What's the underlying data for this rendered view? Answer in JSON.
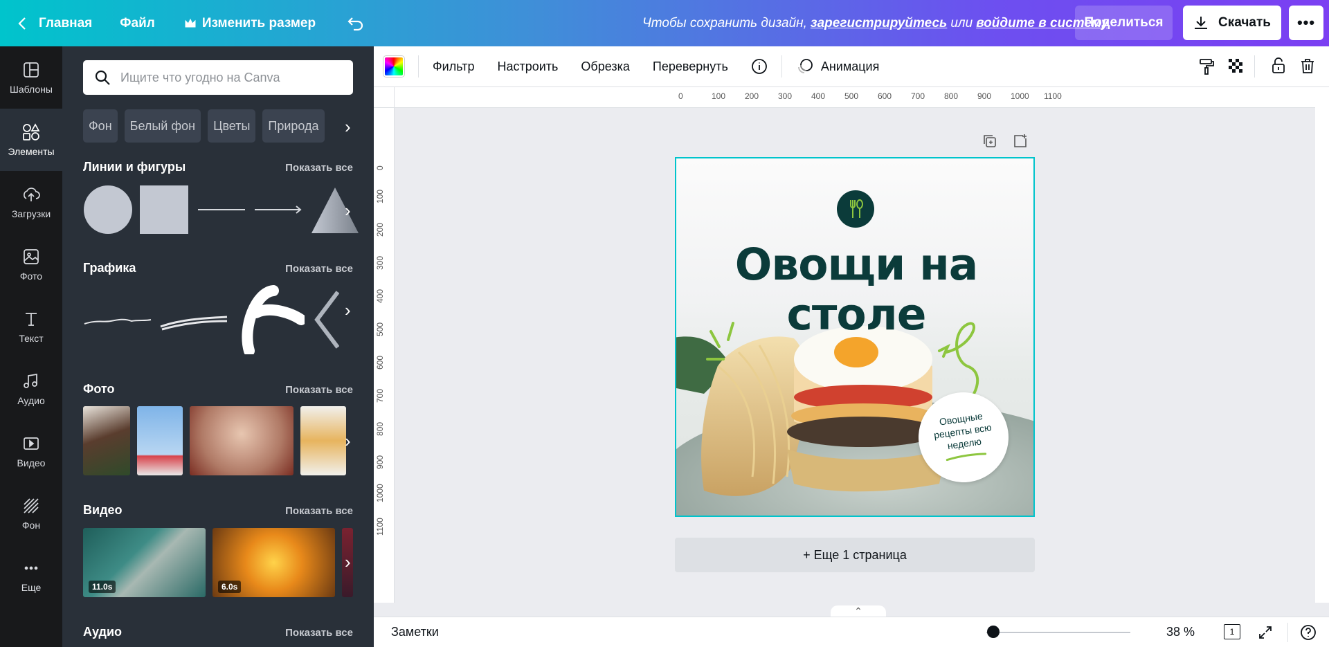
{
  "topbar": {
    "home_label": "Главная",
    "file_label": "Файл",
    "resize_label": "Изменить размер",
    "save_prefix": "Чтобы сохранить дизайн,",
    "register_link": "зарегистрируйтесь",
    "or_text": "или",
    "login_link": "войдите в систему",
    "share_label": "Поделиться",
    "download_label": "Скачать",
    "more_label": "•••"
  },
  "nav": {
    "templates": "Шаблоны",
    "elements": "Элементы",
    "uploads": "Загрузки",
    "photos": "Фото",
    "text": "Текст",
    "audio": "Аудио",
    "video": "Видео",
    "background": "Фон",
    "more": "Еще"
  },
  "panel": {
    "search_placeholder": "Ищите что угодно на Canva",
    "chips": [
      "Фон",
      "Белый фон",
      "Цветы",
      "Природа"
    ],
    "show_all": "Показать все",
    "sections": {
      "lines_shapes": "Линии и фигуры",
      "graphics": "Графика",
      "photos": "Фото",
      "videos": "Видео",
      "audio": "Аудио"
    },
    "video_durations": [
      "11.0s",
      "6.0s"
    ]
  },
  "toolbar": {
    "filter": "Фильтр",
    "adjust": "Настроить",
    "crop": "Обрезка",
    "flip": "Перевернуть",
    "animation": "Анимация"
  },
  "rulers": {
    "top": [
      "0",
      "100",
      "200",
      "300",
      "400",
      "500",
      "600",
      "700",
      "800",
      "900",
      "1000",
      "1100"
    ],
    "left": [
      "0",
      "100",
      "200",
      "300",
      "400",
      "500",
      "600",
      "700",
      "800",
      "900",
      "1000",
      "1100"
    ]
  },
  "design": {
    "headline_line1": "Овощи на",
    "headline_line2": "столе",
    "badge_text": "Овощные рецепты всю неделю",
    "accent_color": "#0b3b3a",
    "highlight_color": "#8dc63f"
  },
  "add_page_label": "+ Еще 1 страница",
  "bottombar": {
    "notes_label": "Заметки",
    "zoom_value": "38 %",
    "zoom_fraction": 0.05,
    "page_count": "1"
  }
}
